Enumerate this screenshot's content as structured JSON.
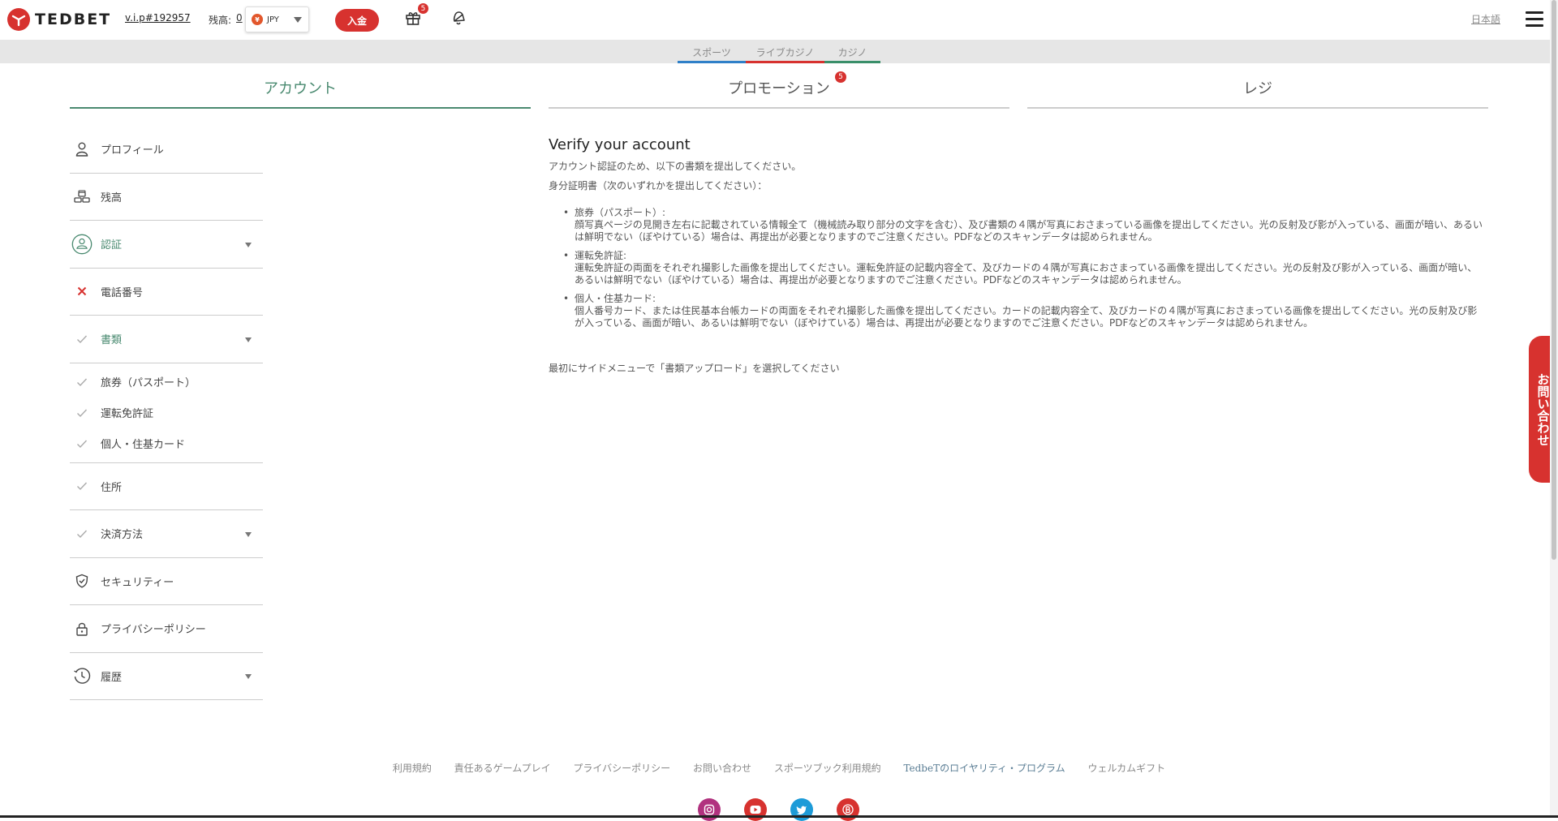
{
  "header": {
    "logo_text": "TEDBET",
    "vip": "v.i.p#192957",
    "balance_label": "残高:",
    "balance_value": "0",
    "currency_coin": "¥",
    "currency_code": "JPY",
    "deposit_label": "入金",
    "gift_badge": "5",
    "language": "日本語"
  },
  "subnav": [
    {
      "label": "スポーツ",
      "color": "#2f80c8"
    },
    {
      "label": "ライブカジノ",
      "color": "#d7322f"
    },
    {
      "label": "カジノ",
      "color": "#3a8f6a"
    }
  ],
  "tabs": [
    {
      "label": "アカウント",
      "active": true
    },
    {
      "label": "プロモーション",
      "badge": "5"
    },
    {
      "label": "レジ"
    }
  ],
  "sidebar": {
    "profile": "プロフィール",
    "balance": "残高",
    "verify": "認証",
    "phone": "電話番号",
    "documents": "書類",
    "docs": [
      "旅券（パスポート）",
      "運転免許証",
      "個人・住基カード"
    ],
    "address": "住所",
    "payment": "決済方法",
    "security": "セキュリティー",
    "privacy": "プライバシーポリシー",
    "history": "履歴"
  },
  "content": {
    "title": "Verify your account",
    "intro": "アカウント認証のため、以下の書類を提出してください。",
    "id_label": "身分証明書（次のいずれかを提出してください）：",
    "items": [
      {
        "title": "旅券（パスポート）:",
        "desc": "顔写真ページの見開き左右に記載されている情報全て（機械読み取り部分の文字を含む）、及び書類の４隅が写真におさまっている画像を提出してください。光の反射及び影が入っている、画面が暗い、あるいは鮮明でない（ぼやけている）場合は、再提出が必要となりますのでご注意ください。PDFなどのスキャンデータは認められません。"
      },
      {
        "title": "運転免許証:",
        "desc": "運転免許証の両面をそれぞれ撮影した画像を提出してください。運転免許証の記載内容全て、及びカードの４隅が写真におさまっている画像を提出してください。光の反射及び影が入っている、画面が暗い、あるいは鮮明でない（ぼやけている）場合は、再提出が必要となりますのでご注意ください。PDFなどのスキャンデータは認められません。"
      },
      {
        "title": "個人・住基カード:",
        "desc": "個人番号カード、または住民基本台帳カードの両面をそれぞれ撮影した画像を提出してください。カードの記載内容全て、及びカードの４隅が写真におさまっている画像を提出してください。光の反射及び影が入っている、画面が暗い、あるいは鮮明でない（ぼやけている）場合は、再提出が必要となりますのでご注意ください。PDFなどのスキャンデータは認められません。"
      }
    ],
    "note": "最初にサイドメニューで「書類アップロード」を選択してください"
  },
  "contact_tab": "お問い合わせ",
  "footer": {
    "links": [
      "利用規約",
      "責任あるゲームプレイ",
      "プライバシーポリシー",
      "お問い合わせ",
      "スポーツブック利用規約",
      "TedbeTのロイヤリティ・プログラム",
      "ウェルカムギフト"
    ],
    "social": [
      {
        "name": "instagram-icon",
        "color": "#b1327f"
      },
      {
        "name": "youtube-icon",
        "color": "#d7322f"
      },
      {
        "name": "twitter-icon",
        "color": "#1d9bd8"
      },
      {
        "name": "blog-icon",
        "color": "#d7322f"
      }
    ]
  }
}
